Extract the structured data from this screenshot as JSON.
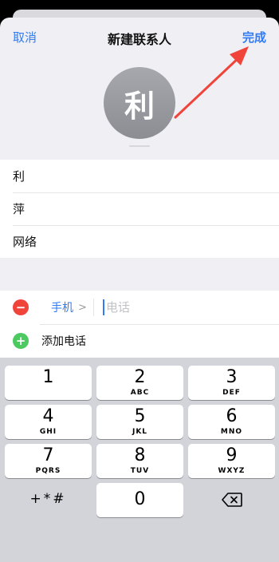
{
  "nav": {
    "cancel": "取消",
    "title": "新建联系人",
    "done": "完成"
  },
  "avatar": {
    "initial": "利"
  },
  "name_fields": [
    {
      "value": "利"
    },
    {
      "value": "萍"
    },
    {
      "value": "网络"
    }
  ],
  "phone": {
    "type_label": "手机",
    "chevron": ">",
    "placeholder": "电话",
    "add_label": "添加电话"
  },
  "keypad": {
    "keys": [
      {
        "num": "1",
        "letters": ""
      },
      {
        "num": "2",
        "letters": "ABC"
      },
      {
        "num": "3",
        "letters": "DEF"
      },
      {
        "num": "4",
        "letters": "GHI"
      },
      {
        "num": "5",
        "letters": "JKL"
      },
      {
        "num": "6",
        "letters": "MNO"
      },
      {
        "num": "7",
        "letters": "PQRS"
      },
      {
        "num": "8",
        "letters": "TUV"
      },
      {
        "num": "9",
        "letters": "WXYZ"
      },
      {
        "num": "0",
        "letters": ""
      }
    ],
    "symbols": "+*#"
  },
  "colors": {
    "accent": "#2f7cf6",
    "arrow": "#f0443b",
    "delete": "#f0443b",
    "add": "#4cc961"
  }
}
